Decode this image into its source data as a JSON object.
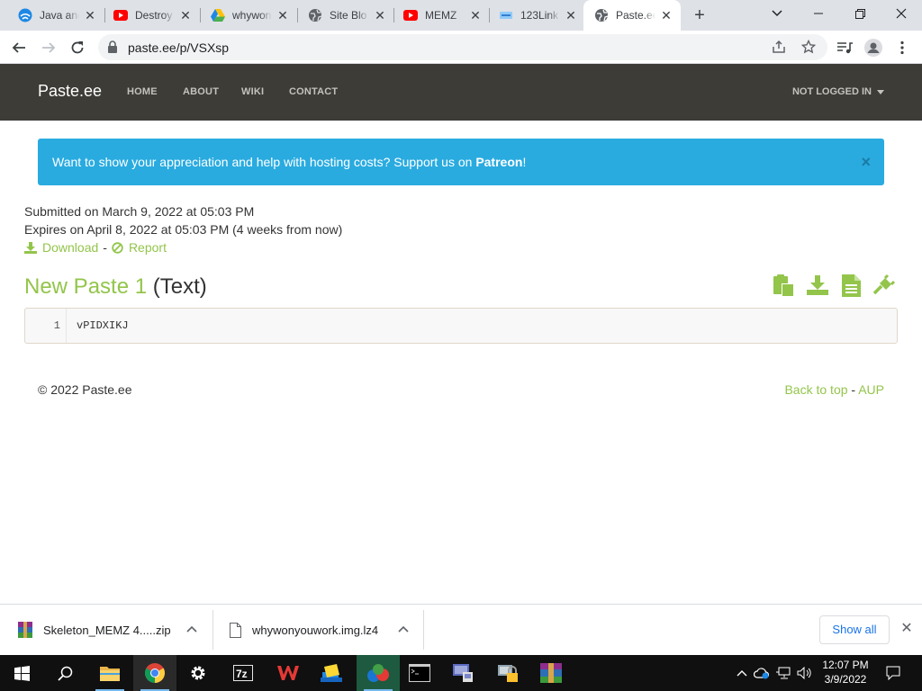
{
  "browser": {
    "tabs": [
      {
        "title": "Java and",
        "icon": "globe-blue-icon"
      },
      {
        "title": "Destroy",
        "icon": "youtube-icon"
      },
      {
        "title": "whywon",
        "icon": "google-drive-icon"
      },
      {
        "title": "Site Blo",
        "icon": "globe-icon"
      },
      {
        "title": "MEMZ",
        "icon": "youtube-icon"
      },
      {
        "title": "123Link",
        "icon": "site-icon"
      },
      {
        "title": "Paste.ee",
        "icon": "globe-icon",
        "active": true
      }
    ],
    "url": "paste.ee/p/VSXsp"
  },
  "site": {
    "brand": "Paste.ee",
    "nav": [
      "HOME",
      "ABOUT",
      "WIKI",
      "CONTACT"
    ],
    "login": "NOT LOGGED IN"
  },
  "alert": {
    "text": "Want to show your appreciation and help with hosting costs? Support us on ",
    "link": "Patreon",
    "suffix": "!",
    "close": "×"
  },
  "paste": {
    "submitted": "Submitted on March 9, 2022 at 05:03 PM",
    "expires": "Expires on April 8, 2022 at 05:03 PM (4 weeks from now)",
    "download": "Download",
    "separator": "-",
    "report": "Report",
    "title": "New Paste 1",
    "type": "(Text)",
    "lines": [
      {
        "number": "1",
        "code": "vPIDXIKJ"
      }
    ]
  },
  "footer": {
    "copyright": "© 2022 Paste.ee",
    "back_to_top": "Back to top",
    "separator": "-",
    "aup": "AUP"
  },
  "downloads": {
    "items": [
      "Skeleton_MEMZ 4.....zip",
      "whywonyouwork.img.lz4"
    ],
    "show_all": "Show all"
  },
  "taskbar": {
    "time": "12:07 PM",
    "date": "3/9/2022"
  },
  "colors": {
    "accent_green": "#93c54b",
    "alert_blue": "#29abe0",
    "navbar": "#3d3c37"
  }
}
